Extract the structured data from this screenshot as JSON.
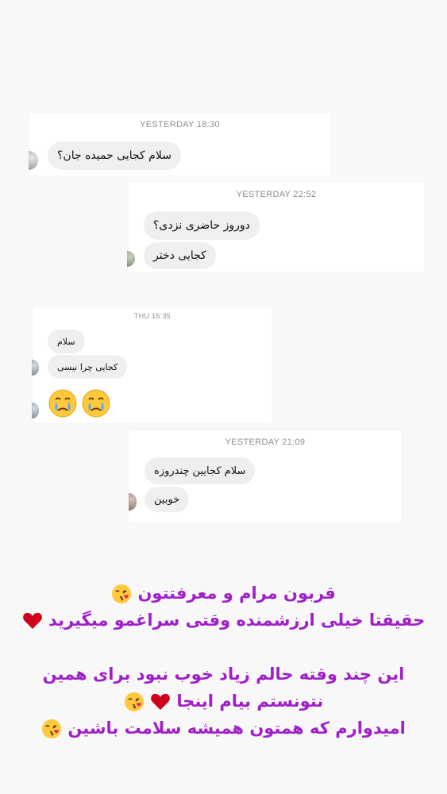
{
  "conversations": [
    {
      "timestamp": "YESTERDAY 18:30",
      "messages": [
        "سلام کجایی حمیده جان؟"
      ]
    },
    {
      "timestamp": "YESTERDAY 22:52",
      "messages": [
        "دوروز حاضری نزدی؟",
        "کجایی دختر"
      ]
    },
    {
      "timestamp": "THU 15:35",
      "messages": [
        "سلام",
        "کجایی چرا نیسی"
      ],
      "emoji_message": "crying-face-emoji x2"
    },
    {
      "timestamp": "YESTERDAY 21:09",
      "messages": [
        "سلام کجایین چندروزه",
        "خوبین"
      ]
    }
  ],
  "caption": {
    "line1": "قربون مرام و معرفتتون",
    "line2": "حقیقتا خیلی ارزشمنده وقتی سراغمو میگیرید",
    "line3": "این چند وقته حالم زیاد خوب نبود برای همین",
    "line4": "نتونستم بیام اینجا",
    "line5": "امیدوارم که همتون همیشه سلامت باشین"
  },
  "colors": {
    "caption_text": "#a020c8",
    "bubble_bg": "#efeff0",
    "heart": "#d0021b"
  },
  "icons": [
    "kissing-face-emoji",
    "red-heart-emoji",
    "crying-face-emoji"
  ]
}
